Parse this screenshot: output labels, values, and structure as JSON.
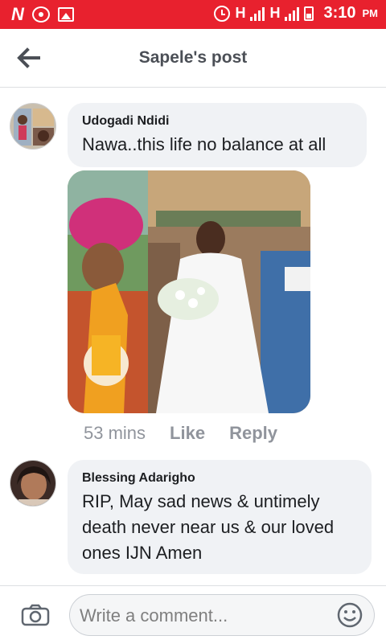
{
  "status_bar": {
    "network_1": "H",
    "network_2": "H",
    "time": "3:10",
    "ampm": "PM"
  },
  "header": {
    "title": "Sapele's post"
  },
  "comments": [
    {
      "author": "Udogadi Ndidi",
      "text": "Nawa..this life no balance at all",
      "time": "53 mins",
      "like_label": "Like",
      "reply_label": "Reply",
      "has_photo": true
    },
    {
      "author": "Blessing Adarigho",
      "text": "RIP, May sad news & untimely death never near us & our loved ones IJN Amen"
    }
  ],
  "composer": {
    "placeholder": "Write a comment..."
  },
  "icons": {
    "back": "back-arrow-icon",
    "camera": "camera-icon",
    "emoji": "emoji-icon"
  },
  "colors": {
    "status_bar": "#e8212e",
    "bubble": "#f0f2f5",
    "meta_text": "#90949c"
  }
}
